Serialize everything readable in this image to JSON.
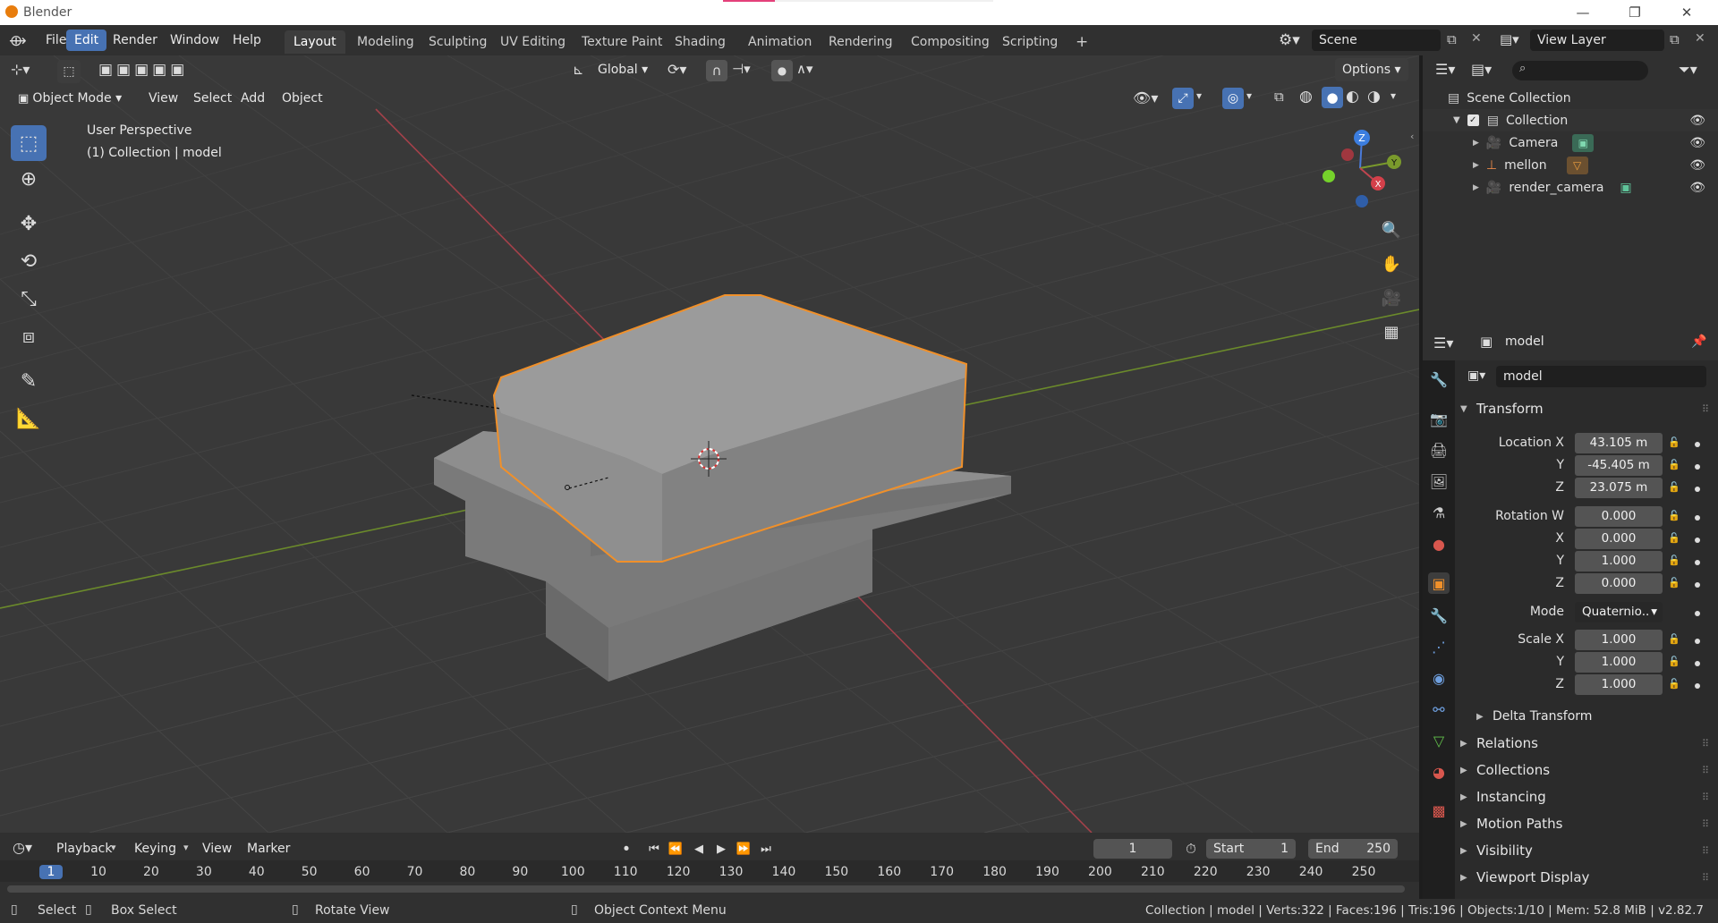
{
  "window": {
    "title": "Blender",
    "minimize": "—",
    "restore": "❐",
    "close": "✕"
  },
  "menu": [
    "File",
    "Edit",
    "Render",
    "Window",
    "Help"
  ],
  "menu_active": "Edit",
  "workspaces": [
    "Layout",
    "Modeling",
    "Sculpting",
    "UV Editing",
    "Texture Paint",
    "Shading",
    "Animation",
    "Rendering",
    "Compositing",
    "Scripting"
  ],
  "workspace_active": "Layout",
  "add_workspace": "+",
  "scene": {
    "name": "Scene"
  },
  "view_layer": {
    "name": "View Layer"
  },
  "viewport": {
    "mode": "Object Mode",
    "header_menus": [
      "View",
      "Select",
      "Add",
      "Object"
    ],
    "transform_orientation": "Global",
    "options_label": "Options",
    "overlay_title": "User Perspective",
    "overlay_subtitle": "(1) Collection | model",
    "gizmo": {
      "z": "Z",
      "y": "Y",
      "x": "X"
    }
  },
  "outliner": {
    "root": "Scene Collection",
    "collection": "Collection",
    "items": [
      "Camera",
      "mellon",
      "render_camera"
    ]
  },
  "properties": {
    "object_name_header": "model",
    "object_name_field": "model",
    "transform_label": "Transform",
    "location": {
      "label": "Location X",
      "x": "43.105 m",
      "y": "-45.405 m",
      "z": "23.075 m"
    },
    "rotation": {
      "label": "Rotation W",
      "w": "0.000",
      "x": "0.000",
      "y": "1.000",
      "z": "0.000"
    },
    "mode": {
      "label": "Mode",
      "value": "Quaternio.."
    },
    "scale": {
      "label": "Scale X",
      "x": "1.000",
      "y": "1.000",
      "z": "1.000"
    },
    "axis_labels": {
      "y": "Y",
      "z": "Z",
      "x": "X"
    },
    "delta_transform": "Delta Transform",
    "panels": [
      "Relations",
      "Collections",
      "Instancing",
      "Motion Paths",
      "Visibility",
      "Viewport Display"
    ]
  },
  "timeline": {
    "menus": [
      "Playback",
      "Keying",
      "View",
      "Marker"
    ],
    "current_frame": "1",
    "start_label": "Start",
    "start": "1",
    "end_label": "End",
    "end": "250",
    "ticks": [
      "1",
      "10",
      "20",
      "30",
      "40",
      "50",
      "60",
      "70",
      "80",
      "90",
      "100",
      "110",
      "120",
      "130",
      "140",
      "150",
      "160",
      "170",
      "180",
      "190",
      "200",
      "210",
      "220",
      "230",
      "240",
      "250"
    ]
  },
  "status": {
    "select": "Select",
    "box_select": "Box Select",
    "rotate_view": "Rotate View",
    "context_menu": "Object Context Menu",
    "stats": "Collection | model | Verts:322 | Faces:196 | Tris:196 | Objects:1/10 | Mem: 52.8 MiB | v2.82.7"
  },
  "colors": {
    "accent": "#4772b3",
    "selection_outline": "#f0902a",
    "x_axis": "#c0454f",
    "y_axis": "#7a9a2c"
  }
}
